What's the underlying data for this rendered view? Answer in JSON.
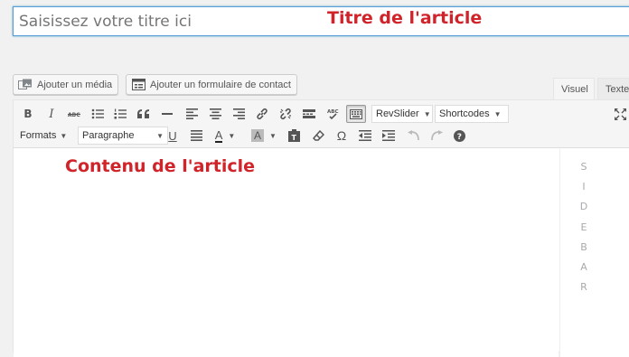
{
  "title_field": {
    "placeholder": "Saisissez votre titre ici"
  },
  "annotations": {
    "title": "Titre de l'article",
    "content": "Contenu de l'article"
  },
  "media_buttons": {
    "add_media": "Ajouter un média",
    "add_contact_form": "Ajouter un formulaire de contact"
  },
  "editor_tabs": {
    "visual": "Visuel",
    "text": "Texte"
  },
  "toolbar": {
    "revslider": "RevSlider",
    "shortcodes": "Shortcodes",
    "formats": "Formats",
    "paragraph": "Paragraphe",
    "text_color_glyph": "A",
    "bg_color_glyph": "A",
    "omega": "Ω",
    "bold_glyph": "B",
    "italic_glyph": "I",
    "underline_glyph": "U"
  },
  "sidebar": {
    "letters": [
      "S",
      "I",
      "D",
      "E",
      "B",
      "A",
      "R"
    ]
  }
}
